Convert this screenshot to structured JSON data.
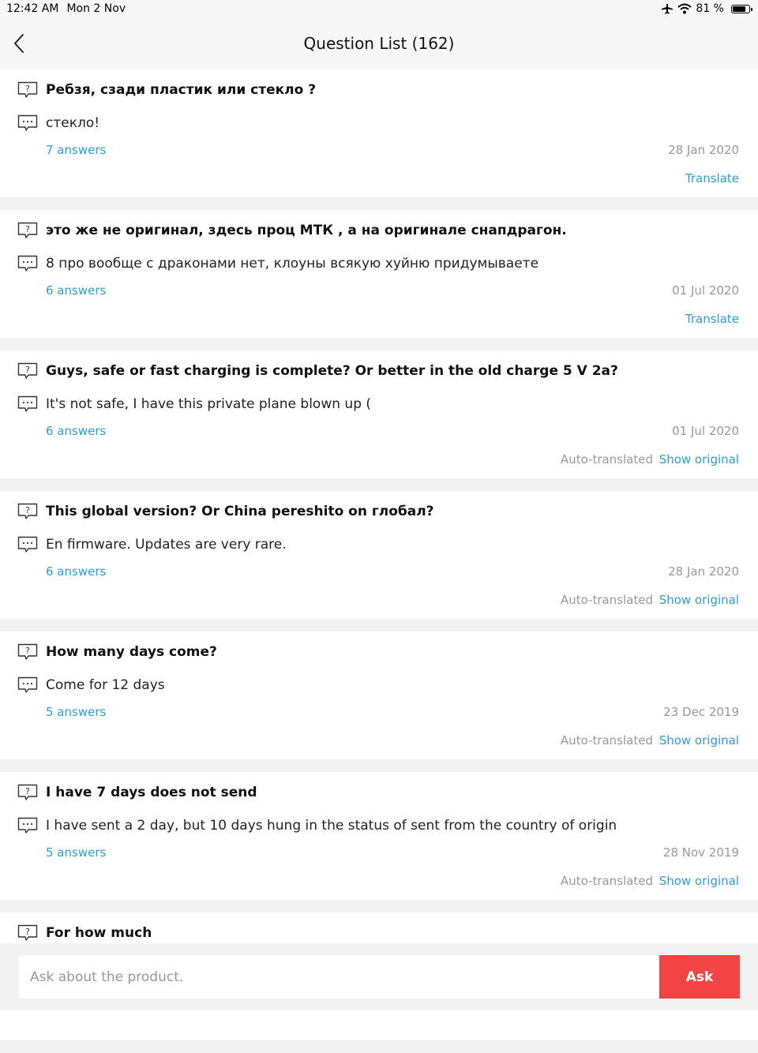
{
  "status_bar": {
    "time": "12:42 AM",
    "date": "Mon 2 Nov",
    "battery": "81 %"
  },
  "header": {
    "title": "Question List (162)"
  },
  "questions": [
    {
      "question": "Ребзя, сзади пластик или стекло ?",
      "answer": "стекло!",
      "answers_count": "7 answers",
      "date": "28 Jan 2020",
      "translate": "Translate"
    },
    {
      "question": "это же не оригинал, здесь проц МТК , а на оригинале снапдрагон.",
      "answer": "8 про вообще с драконами нет, клоуны всякую хуйню придумываете",
      "answers_count": "6 answers",
      "date": "01 Jul 2020",
      "translate": "Translate"
    },
    {
      "question": "Guys, safe or fast charging is complete? Or better in the old charge 5 V 2a?",
      "answer": "It's not safe, I have this private plane blown up (",
      "answers_count": "6 answers",
      "date": "01 Jul 2020",
      "auto_translated": "Auto-translated",
      "show_original": "Show original"
    },
    {
      "question": "This global version? Or China pereshito on глобал?",
      "answer": "En firmware. Updates are very rare.",
      "answers_count": "6 answers",
      "date": "28 Jan 2020",
      "auto_translated": "Auto-translated",
      "show_original": "Show original"
    },
    {
      "question": "How many days come?",
      "answer": "Come for 12 days",
      "answers_count": "5 answers",
      "date": "23 Dec 2019",
      "auto_translated": "Auto-translated",
      "show_original": "Show original"
    },
    {
      "question": "I have 7 days does not send",
      "answer": "I have sent a 2 day, but 10 days hung in the status of sent from the country of origin",
      "answers_count": "5 answers",
      "date": "28 Nov 2019",
      "auto_translated": "Auto-translated",
      "show_original": "Show original"
    },
    {
      "question": "For how much"
    }
  ],
  "ask_bar": {
    "placeholder": "Ask about the product.",
    "button_label": "Ask"
  },
  "colors": {
    "link": "#2b9fd6",
    "accent": "#f24444",
    "muted": "#999999"
  }
}
